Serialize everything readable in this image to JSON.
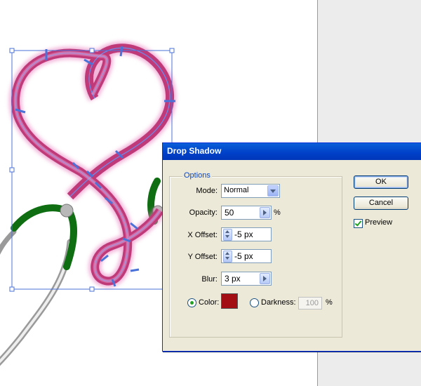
{
  "dialog": {
    "title": "Drop Shadow",
    "options_legend": "Options",
    "mode": {
      "label": "Mode:",
      "value": "Normal"
    },
    "opacity": {
      "label": "Opacity:",
      "value": "50",
      "unit": "%"
    },
    "x_offset": {
      "label": "X Offset:",
      "value": "-5 px"
    },
    "y_offset": {
      "label": "Y Offset:",
      "value": "-5 px"
    },
    "blur": {
      "label": "Blur:",
      "value": "3 px"
    },
    "color": {
      "label": "Color:",
      "selected": true,
      "swatch": "#a30d14"
    },
    "darkness": {
      "label": "Darkness:",
      "value": "100",
      "unit": "%",
      "selected": false
    },
    "ok_label": "OK",
    "cancel_label": "Cancel",
    "preview": {
      "label": "Preview",
      "checked": true
    }
  },
  "colors": {
    "titlebar": "#0054e3",
    "dialog_bg": "#ece9d8",
    "heart_stroke": "#c03a7a",
    "stethoscope_green": "#0f6e12",
    "selection_blue": "#4a72d8"
  }
}
